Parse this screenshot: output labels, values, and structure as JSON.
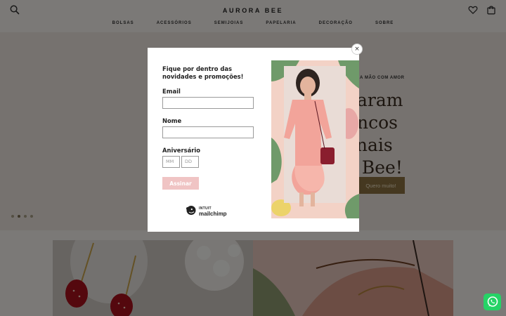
{
  "header": {
    "logo": "AURORA BEE",
    "nav": [
      "BOLSAS",
      "ACESSÓRIOS",
      "SEMIJOIAS",
      "PAPELARIA",
      "DECORAÇÃO",
      "SOBRE"
    ],
    "icons": {
      "search": "search-icon",
      "wishlist": "heart-icon",
      "cart": "bag-icon"
    }
  },
  "hero": {
    "tag": "A MÃO COM AMOR",
    "title_lines": [
      "garam",
      "lincos",
      "anais",
      "a Bee!"
    ],
    "button_label": "Quero muito!",
    "slide_count": 4,
    "active_slide": 2
  },
  "modal": {
    "heading": "Fique por dentro das novidades e promoções!",
    "email_label": "Email",
    "email_value": "",
    "name_label": "Nome",
    "name_value": "",
    "birthday_label": "Aniversário",
    "month_placeholder": "MM",
    "day_placeholder": "DD",
    "submit_label": "Assinar",
    "close_label": "×",
    "brand_top": "INTUIT",
    "brand_name": "mailchimp"
  },
  "colors": {
    "accent_button": "#8a7040",
    "submit_button": "#f0c4c4",
    "whatsapp": "#25d366"
  },
  "floating": {
    "whatsapp": "whatsapp-icon"
  }
}
